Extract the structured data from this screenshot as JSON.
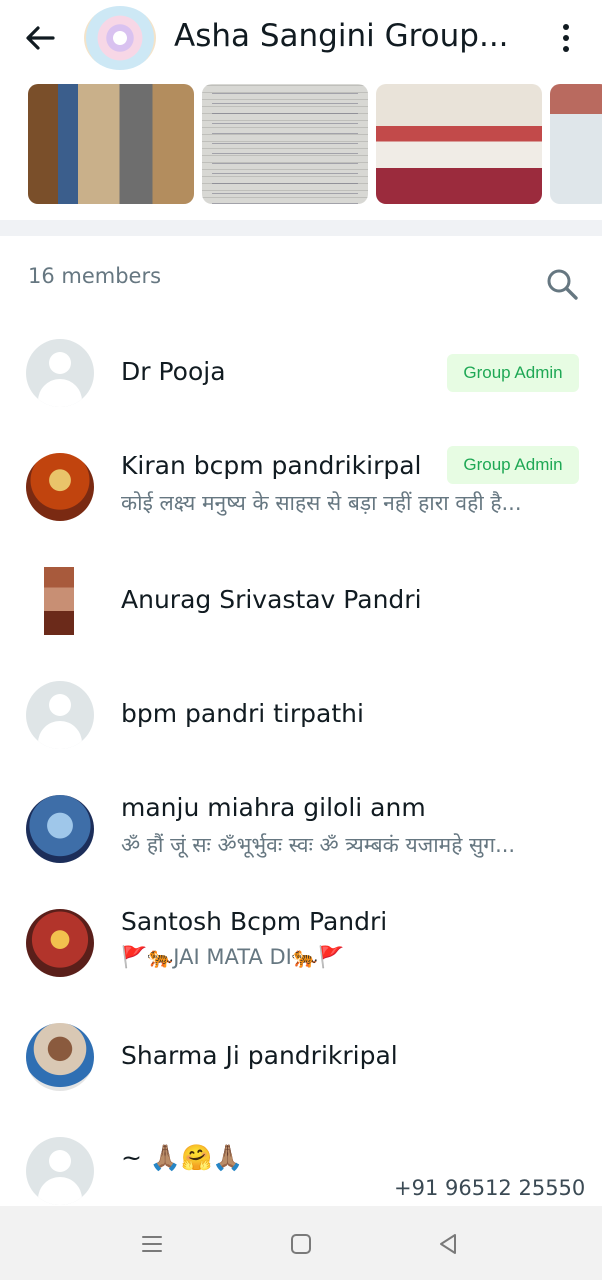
{
  "header": {
    "title": "Asha Sangini Group...",
    "back_icon": "arrow-left-icon",
    "menu_icon": "more-vertical-icon"
  },
  "media": [
    "photo",
    "document-photo",
    "photo",
    "photo"
  ],
  "members_header": {
    "count_label": "16 members",
    "search_icon": "search-icon"
  },
  "members": [
    {
      "name": "Dr Pooja",
      "about": "",
      "badge": "Group Admin"
    },
    {
      "name": "Kiran bcpm pandrikirpal",
      "about": "कोई लक्ष्य मनुष्य के साहस से बड़ा नहीं हारा वही है...",
      "badge": "Group Admin"
    },
    {
      "name": "Anurag Srivastav Pandri",
      "about": "",
      "badge": ""
    },
    {
      "name": "bpm pandri tirpathi",
      "about": "",
      "badge": ""
    },
    {
      "name": "manju miahra giloli anm",
      "about": "ॐ हौं जूं सः ॐभूर्भुवः स्वः ॐ त्र्यम्बकं यजामहे सुग...",
      "badge": ""
    },
    {
      "name": "Santosh Bcpm Pandri",
      "about": "🚩🐅JAI MATA DI🐅🚩",
      "badge": ""
    },
    {
      "name": "Sharma Ji pandrikripal",
      "about": "",
      "badge": ""
    },
    {
      "name": "~ 🙏🏽🤗🙏🏽",
      "about": "",
      "badge": "",
      "phone": "+91 96512 25550"
    }
  ],
  "colors": {
    "accent_green": "#1fa855",
    "badge_bg": "#e7fce3",
    "secondary_text": "#667781"
  },
  "navbar": {
    "menu_icon": "recent-apps-icon",
    "home_icon": "home-icon",
    "back_icon": "back-triangle-icon"
  }
}
